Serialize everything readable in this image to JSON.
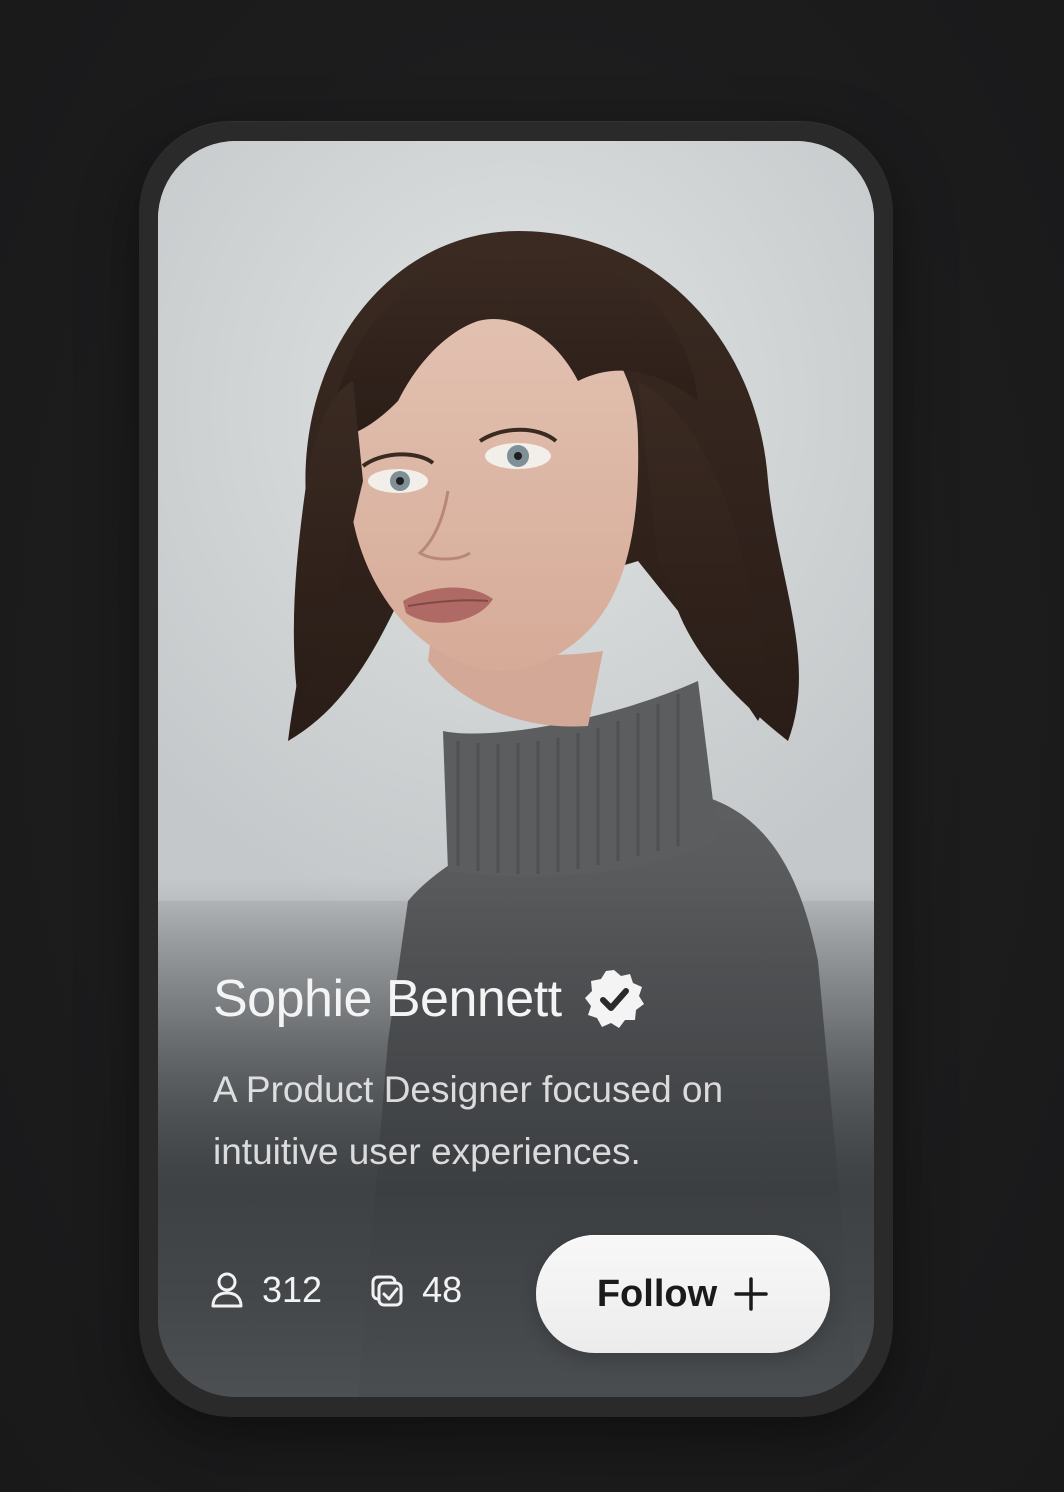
{
  "profile": {
    "name": "Sophie Bennett",
    "bio": "A Product Designer focused on intuitive user experiences.",
    "verified_icon": "verified-badge-icon"
  },
  "stats": {
    "followers": {
      "icon": "user-icon",
      "value": "312"
    },
    "projects": {
      "icon": "projects-icon",
      "value": "48"
    }
  },
  "actions": {
    "follow_label": "Follow",
    "follow_icon": "plus-icon"
  },
  "colors": {
    "background": "#1d1d1e",
    "card_frame": "#2a2a2b",
    "text_primary": "#f4f4f4",
    "button_bg": "#f4f4f4",
    "button_text": "#1a1a1a"
  }
}
